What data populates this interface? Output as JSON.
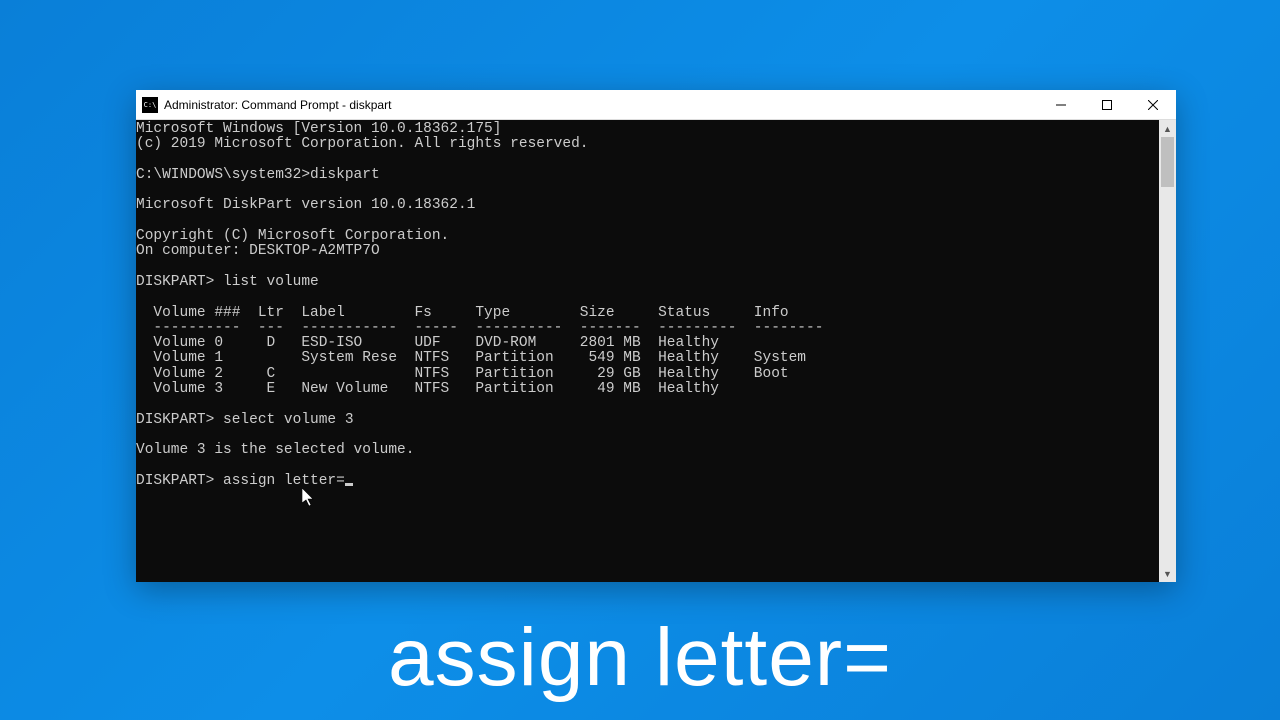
{
  "window": {
    "title": "Administrator: Command Prompt - diskpart",
    "icon_label": "C:\\"
  },
  "console": {
    "lines": {
      "os_version": "Microsoft Windows [Version 10.0.18362.175]",
      "copyright1": "(c) 2019 Microsoft Corporation. All rights reserved.",
      "prompt1": "C:\\WINDOWS\\system32>diskpart",
      "diskpart_ver": "Microsoft DiskPart version 10.0.18362.1",
      "copyright2": "Copyright (C) Microsoft Corporation.",
      "computer": "On computer: DESKTOP-A2MTP7O",
      "prompt2": "DISKPART> list volume",
      "header": "  Volume ###  Ltr  Label        Fs     Type        Size     Status     Info",
      "divider": "  ----------  ---  -----------  -----  ----------  -------  ---------  --------",
      "vol0": "  Volume 0     D   ESD-ISO      UDF    DVD-ROM     2801 MB  Healthy",
      "vol1": "  Volume 1         System Rese  NTFS   Partition    549 MB  Healthy    System",
      "vol2": "  Volume 2     C                NTFS   Partition     29 GB  Healthy    Boot",
      "vol3": "  Volume 3     E   New Volume   NTFS   Partition     49 MB  Healthy",
      "prompt3": "DISKPART> select volume 3",
      "selected": "Volume 3 is the selected volume.",
      "prompt4_pre": "DISKPART> ",
      "prompt4_cmd": "assign letter="
    }
  },
  "caption": "assign letter="
}
